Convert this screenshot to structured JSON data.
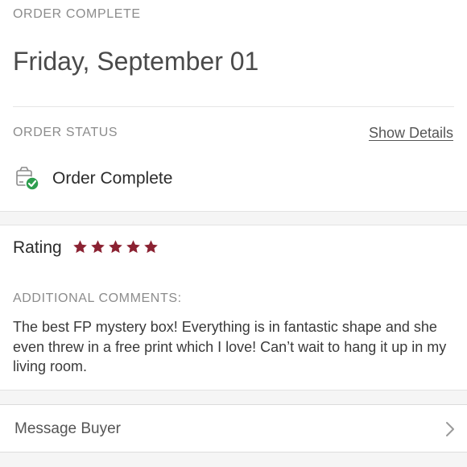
{
  "header": {
    "section_title": "ORDER COMPLETE",
    "date": "Friday, September 01"
  },
  "order_status": {
    "label": "ORDER STATUS",
    "show_details": "Show Details",
    "status_text": "Order Complete",
    "status_icon": "box-check-icon",
    "status_color": "#2e9e4f"
  },
  "rating": {
    "label": "Rating",
    "stars": 5,
    "star_color": "#8b2232"
  },
  "comments": {
    "label": "ADDITIONAL COMMENTS:",
    "text": "The best FP mystery box! Everything is in fantastic shape and she even threw in a free print which I love! Can’t wait to hang it up in my living room."
  },
  "actions": {
    "message_buyer": "Message Buyer",
    "message_buyer_icon": "chevron-right-icon"
  }
}
